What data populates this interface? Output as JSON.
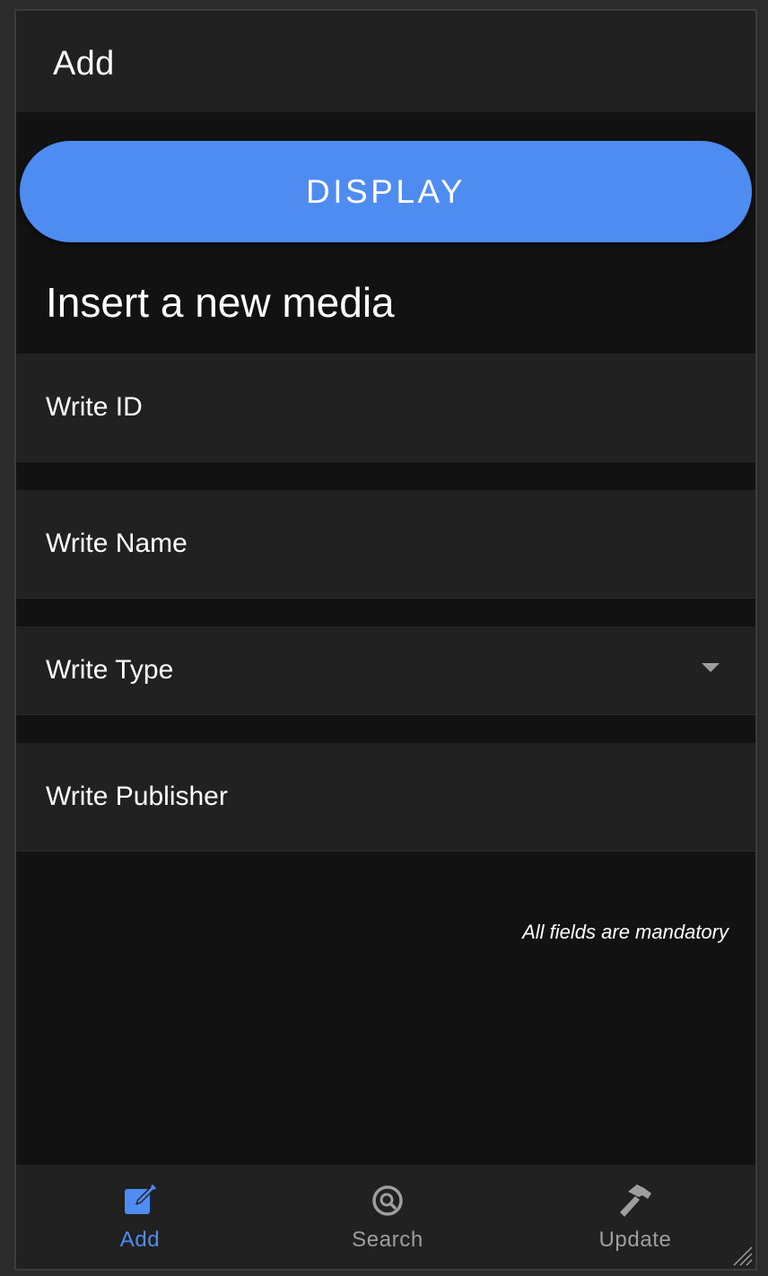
{
  "appbar": {
    "title": "Add"
  },
  "display_button": {
    "label": "DISPLAY"
  },
  "form": {
    "heading": "Insert a new media",
    "fields": {
      "id": {
        "placeholder": "Write ID"
      },
      "name": {
        "placeholder": "Write Name"
      },
      "type": {
        "label": "Write Type",
        "icon": "dropdown-arrow-icon"
      },
      "publisher": {
        "placeholder": "Write Publisher"
      }
    },
    "hint": "All fields are mandatory"
  },
  "bottom_nav": {
    "items": [
      {
        "label": "Add",
        "icon": "edit-icon",
        "active": true
      },
      {
        "label": "Search",
        "icon": "search-icon",
        "active": false
      },
      {
        "label": "Update",
        "icon": "hammer-icon",
        "active": false
      }
    ]
  },
  "colors": {
    "accent": "#4f8cf2",
    "surface": "#212121",
    "background": "#121212",
    "inactive": "#9e9e9e"
  }
}
